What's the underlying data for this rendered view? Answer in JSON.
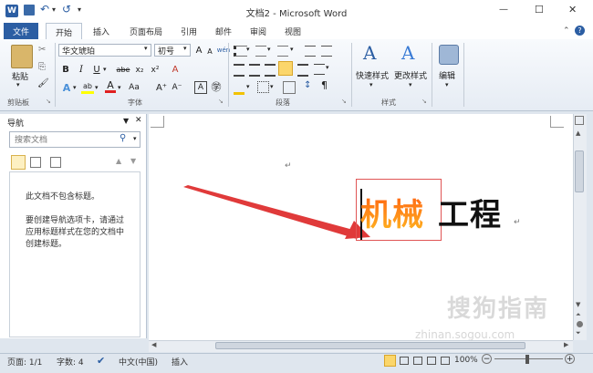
{
  "window": {
    "title": "文档2 - Microsoft Word",
    "min": "—",
    "max": "☐",
    "close": "✕"
  },
  "qat": {
    "word_icon": "W",
    "save": "💾",
    "undo": "↶",
    "redo": "↺",
    "more": "▾"
  },
  "tabs": {
    "file": "文件",
    "items": [
      "开始",
      "插入",
      "页面布局",
      "引用",
      "邮件",
      "审阅",
      "视图"
    ]
  },
  "ribbon": {
    "clipboard": {
      "paste": "粘贴",
      "cut": "✂",
      "copy": "⎘",
      "format_painter": "🖌",
      "label": "剪贴板"
    },
    "font": {
      "family": "华文琥珀",
      "size": "初号",
      "grow": "A",
      "shrink": "A",
      "bold": "B",
      "italic": "I",
      "underline": "U",
      "strike": "abe",
      "sub": "x₂",
      "sup": "x²",
      "clear": "A",
      "wen": "wén",
      "effects": "A",
      "highlight": "ab",
      "color": "A",
      "case": "Aa",
      "grow2": "A⁺",
      "shrink2": "A⁻",
      "border": "A",
      "circle": "㊫",
      "label": "字体"
    },
    "paragraph": {
      "label": "段落",
      "pilcrow": "¶"
    },
    "styles": {
      "quick": "快速样式",
      "change": "更改样式",
      "label": "样式"
    },
    "editing": {
      "label": "编辑"
    }
  },
  "nav": {
    "title": "导航",
    "search_placeholder": "搜索文档",
    "no_headings": "此文档不包含标题。",
    "help_lines": [
      "要创建导航选项卡，请通过",
      "应用标题样式在您的文档中",
      "创建标题。"
    ]
  },
  "document": {
    "text_part1": "机械",
    "text_part2": "工程",
    "para_mark": "↵"
  },
  "watermark": {
    "main": "搜狗指南",
    "url": "zhinan.sogou.com"
  },
  "status": {
    "page": "页面: 1/1",
    "words": "字数: 4",
    "lang": "中文(中国)",
    "mode": "插入",
    "zoom": "100%",
    "minus": "−",
    "plus": "+"
  },
  "colors": {
    "accent": "#2c5ea3",
    "arrow": "#e03a3a",
    "highlight_box": "#e05555"
  }
}
